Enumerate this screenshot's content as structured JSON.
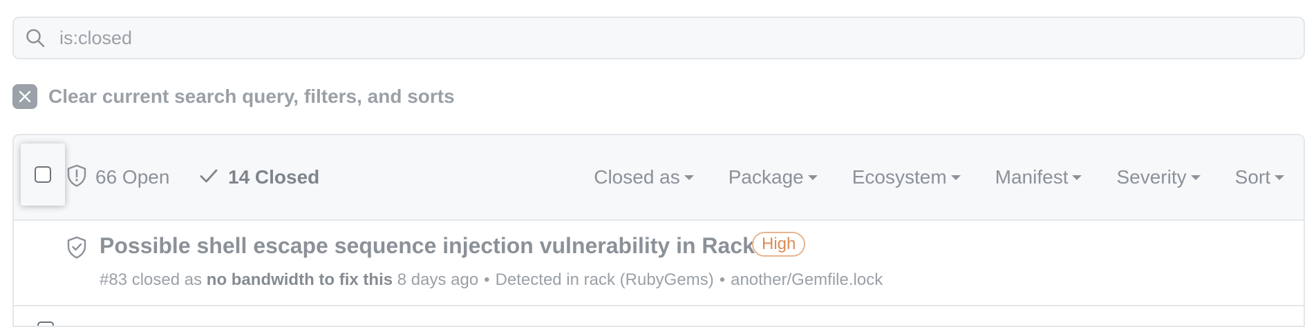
{
  "search": {
    "placeholder": "is:closed"
  },
  "clear": {
    "label": "Clear current search query, filters, and sorts"
  },
  "header": {
    "open_count": "66 Open",
    "closed_count": "14 Closed",
    "filters": [
      {
        "label": "Closed as"
      },
      {
        "label": "Package"
      },
      {
        "label": "Ecosystem"
      },
      {
        "label": "Manifest"
      },
      {
        "label": "Severity"
      },
      {
        "label": "Sort"
      }
    ]
  },
  "alerts": [
    {
      "title": "Possible shell escape sequence injection vulnerability in Rack",
      "severity": "High",
      "number": "#83",
      "closed_as_prefix": "closed as",
      "reason": "no bandwidth to fix this",
      "time": "8 days ago",
      "separator": "•",
      "detected": "Detected in rack (RubyGems)",
      "manifest": "another/Gemfile.lock"
    }
  ],
  "colors": {
    "text": "#8b9198",
    "border": "#e4e7ea",
    "header_bg": "#f6f8fa",
    "severity_high": "#db8b53"
  }
}
